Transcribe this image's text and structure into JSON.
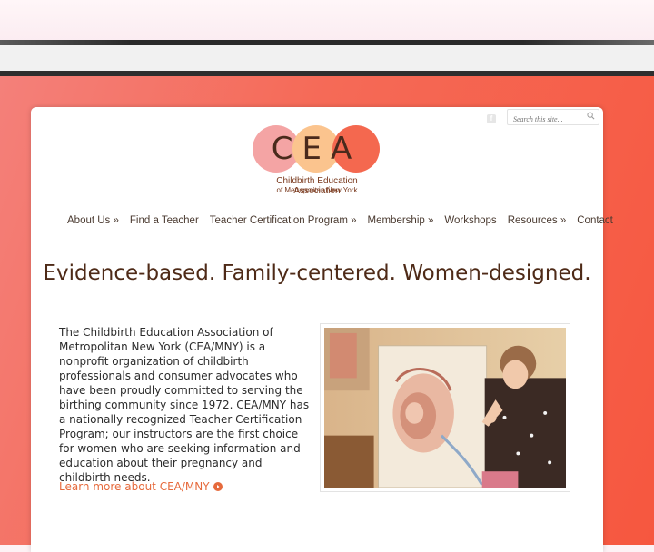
{
  "search": {
    "placeholder": "Search this site..."
  },
  "social": {
    "facebook_glyph": "f"
  },
  "logo": {
    "letters": "CEA",
    "line1": "Childbirth Education Association",
    "line2": "of Metropolitan New York"
  },
  "nav": {
    "items": [
      {
        "label": "About Us »"
      },
      {
        "label": "Find a Teacher"
      },
      {
        "label": "Teacher Certification Program »"
      },
      {
        "label": "Membership »"
      },
      {
        "label": "Workshops"
      },
      {
        "label": "Resources »"
      },
      {
        "label": "Contact"
      }
    ]
  },
  "main": {
    "tagline": "Evidence-based. Family-centered. Women-designed.",
    "intro": "The Childbirth Education Association of Metropolitan New York (CEA/MNY) is a nonprofit organization of childbirth professionals and consumer advocates who have been proudly committed to serving the birthing community since 1972. CEA/MNY has a nationally recognized Teacher Certification Program; our instructors are the first choice for women who are seeking information and education about their pregnancy and childbirth needs.",
    "learn_more": "Learn more about CEA/MNY"
  },
  "colors": {
    "accent": "#e66a3c",
    "brand_brown": "#4e2a17",
    "circle_pink": "#f4a4a4",
    "circle_peach": "#fbc48e",
    "circle_coral": "#f4684f",
    "background_gradient_start": "#f4807a",
    "background_gradient_end": "#f6573f"
  }
}
